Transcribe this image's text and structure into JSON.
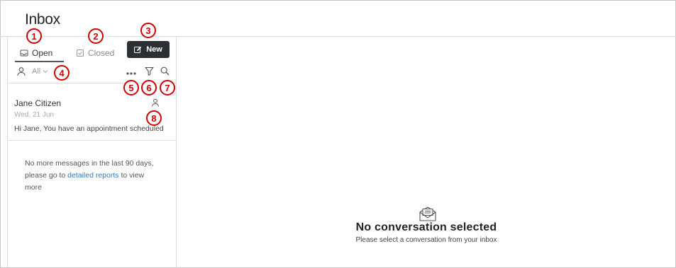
{
  "header": {
    "title": "Inbox"
  },
  "tabs": [
    {
      "label": "Open",
      "icon": "inbox-icon"
    },
    {
      "label": "Closed",
      "icon": "checkbox-icon"
    }
  ],
  "toolbar": {
    "new_label": "New",
    "new_icon": "edit-icon"
  },
  "filters": {
    "assignee_label": "All",
    "more_icon": "more-icon",
    "filter_icon": "funnel-icon",
    "search_icon": "search-icon"
  },
  "conversations": [
    {
      "name": "Jane Citizen",
      "date": "Wed, 21 Jun",
      "snippet": "Hi Jane, You have an appointment scheduled",
      "assignee_icon": "person-icon"
    }
  ],
  "no_more": {
    "text_before": "No more messages in the last 90 days, please go to ",
    "link": "detailed reports",
    "text_after": " to view more"
  },
  "empty_state": {
    "title": "No conversation selected",
    "subtitle": "Please select a conversation from your inbox",
    "icon": "envelope-icon"
  },
  "callouts": [
    "1",
    "2",
    "3",
    "4",
    "5",
    "6",
    "7",
    "8"
  ],
  "colors": {
    "accent_dark": "#2c2f33",
    "callout_red": "#d10000",
    "link_blue": "#2f7ab8"
  }
}
